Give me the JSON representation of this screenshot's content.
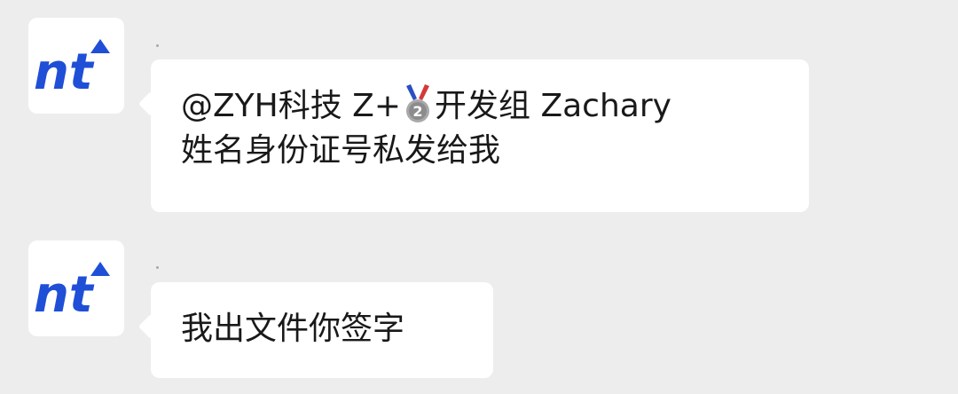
{
  "messages": [
    {
      "avatar_text": "nt",
      "sender_name": "·",
      "mention": "@ZYH科技 Z+",
      "badge": "🥈",
      "mention_suffix": "开发组 Zachary",
      "line2": "姓名身份证号私发给我"
    },
    {
      "avatar_text": "nt",
      "sender_name": "·",
      "line1": "我出文件你签字"
    }
  ],
  "colors": {
    "background": "#ededed",
    "bubble": "#ffffff",
    "logo_blue": "#1f4fd6",
    "text": "#191919"
  }
}
